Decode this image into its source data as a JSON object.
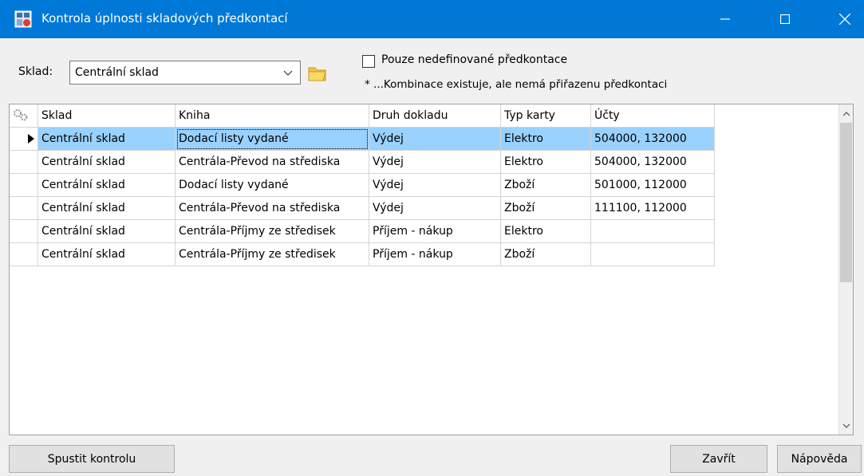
{
  "window": {
    "title": "Kontrola úplnosti skladových předkontací"
  },
  "filter": {
    "sklad_label": "Sklad:",
    "sklad_value": "Centrální sklad",
    "checkbox_label": "Pouze nedefinované předkontace",
    "checkbox_checked": false,
    "note": "* ...Kombinace existuje, ale nemá přiřazenu předkontaci"
  },
  "table": {
    "headers": [
      "Sklad",
      "Kniha",
      "Druh dokladu",
      "Typ karty",
      "Účty"
    ],
    "rows": [
      [
        "Centrální sklad",
        "Dodací listy vydané",
        "Výdej",
        "Elektro",
        "504000, 132000"
      ],
      [
        "Centrální sklad",
        "Centrála-Převod na střediska",
        "Výdej",
        "Elektro",
        "504000, 132000"
      ],
      [
        "Centrální sklad",
        "Dodací listy vydané",
        "Výdej",
        "Zboží",
        "501000, 112000"
      ],
      [
        "Centrální sklad",
        "Centrála-Převod na střediska",
        "Výdej",
        "Zboží",
        "111100, 112000"
      ],
      [
        "Centrální sklad",
        "Centrála-Příjmy ze středisek",
        "Příjem - nákup",
        "Elektro",
        ""
      ],
      [
        "Centrální sklad",
        "Centrála-Příjmy ze středisek",
        "Příjem - nákup",
        "Zboží",
        ""
      ]
    ],
    "selected_row": 0
  },
  "buttons": {
    "run": "Spustit kontrolu",
    "close": "Zavřít",
    "help": "Nápověda"
  },
  "colors": {
    "titlebar": "#0078d7",
    "selection": "#99d1ff"
  }
}
